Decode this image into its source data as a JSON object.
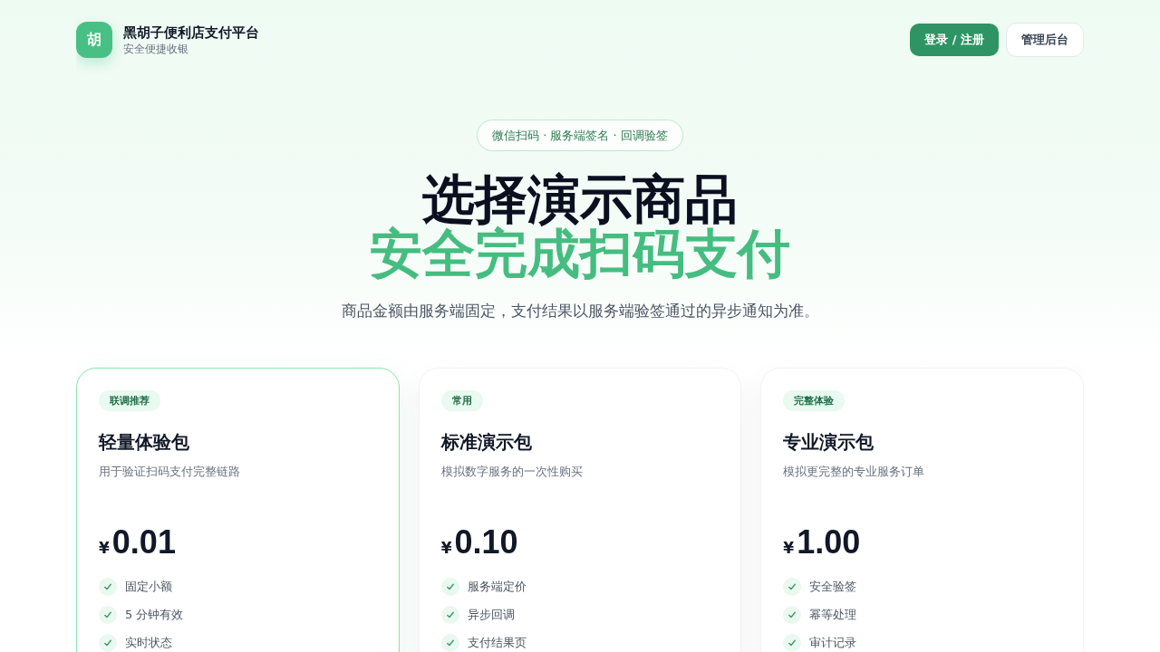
{
  "header": {
    "logo": {
      "mark": "胡",
      "title": "黑胡子便利店支付平台",
      "subtitle": "安全便捷收银"
    },
    "actions": [
      {
        "label": "登录 / 注册",
        "kind": "primary"
      },
      {
        "label": "管理后台",
        "kind": "secondary"
      }
    ]
  },
  "hero": {
    "pill": "微信扫码 · 服务端签名 · 回调验签",
    "headline": "选择演示商品",
    "headline_accent": "安全完成扫码支付",
    "subtitle": "商品金额由服务端固定，支付结果以服务端验签通过的异步通知为准。"
  },
  "products": [
    {
      "badge": "联调推荐",
      "name": "轻量体验包",
      "description": "用于验证扫码支付完整链路",
      "currency": "¥",
      "price": "0.01",
      "features": [
        "固定小额",
        "5 分钟有效",
        "实时状态"
      ],
      "selected": true
    },
    {
      "badge": "常用",
      "name": "标准演示包",
      "description": "模拟数字服务的一次性购买",
      "currency": "¥",
      "price": "0.10",
      "features": [
        "服务端定价",
        "异步回调",
        "支付结果页"
      ],
      "selected": false
    },
    {
      "badge": "完整体验",
      "name": "专业演示包",
      "description": "模拟更完整的专业服务订单",
      "currency": "¥",
      "price": "1.00",
      "features": [
        "安全验签",
        "幂等处理",
        "审计记录"
      ],
      "selected": false
    }
  ]
}
